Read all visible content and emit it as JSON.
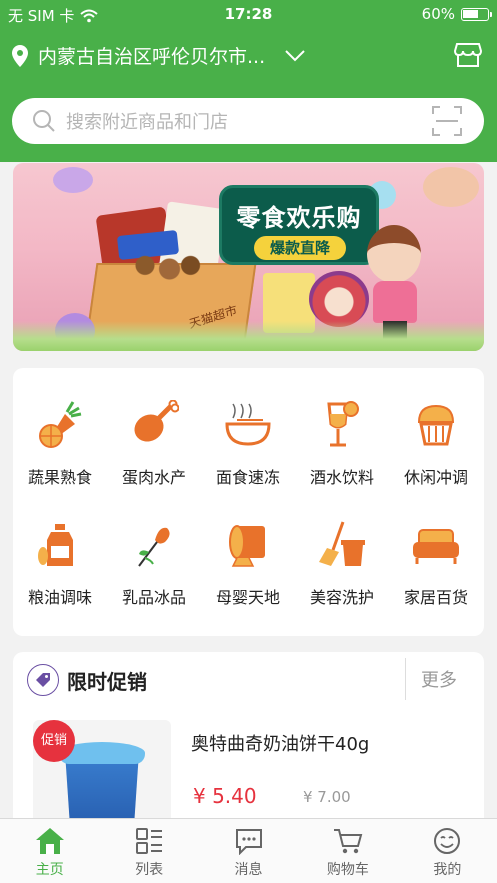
{
  "status_bar": {
    "carrier": "无 SIM 卡",
    "time": "17:28",
    "battery_pct": "60%"
  },
  "header": {
    "location": "内蒙古自治区呼伦贝尔市...",
    "search_placeholder": "搜索附近商品和门店"
  },
  "banner": {
    "headline": "零食欢乐购",
    "subline": "爆款直降",
    "box_label": "天猫超市"
  },
  "categories": [
    {
      "label": "蔬果熟食",
      "icon": "carrot-orange-icon"
    },
    {
      "label": "蛋肉水产",
      "icon": "drumstick-icon"
    },
    {
      "label": "面食速冻",
      "icon": "noodle-bowl-icon"
    },
    {
      "label": "酒水饮料",
      "icon": "wine-glass-icon"
    },
    {
      "label": "休闲冲调",
      "icon": "cupcake-icon"
    },
    {
      "label": "粮油调味",
      "icon": "oil-bottle-icon"
    },
    {
      "label": "乳品冰品",
      "icon": "rose-icon"
    },
    {
      "label": "母婴天地",
      "icon": "tissue-roll-icon"
    },
    {
      "label": "美容洗护",
      "icon": "broom-bucket-icon"
    },
    {
      "label": "家居百货",
      "icon": "sofa-icon"
    }
  ],
  "promo": {
    "title": "限时促销",
    "more": "更多",
    "item": {
      "name": "奥特曲奇奶油饼干40g",
      "badge": "促销",
      "price": "¥ 5.40",
      "original_price": "¥ 7.00"
    }
  },
  "tabbar": [
    {
      "label": "主页",
      "icon": "home-icon",
      "active": true
    },
    {
      "label": "列表",
      "icon": "list-grid-icon",
      "active": false
    },
    {
      "label": "消息",
      "icon": "message-icon",
      "active": false
    },
    {
      "label": "购物车",
      "icon": "cart-icon",
      "active": false
    },
    {
      "label": "我的",
      "icon": "profile-icon",
      "active": false
    }
  ],
  "colors": {
    "brand_green": "#49b049",
    "price_red": "#e6323e",
    "icon_orange": "#e8722b"
  }
}
